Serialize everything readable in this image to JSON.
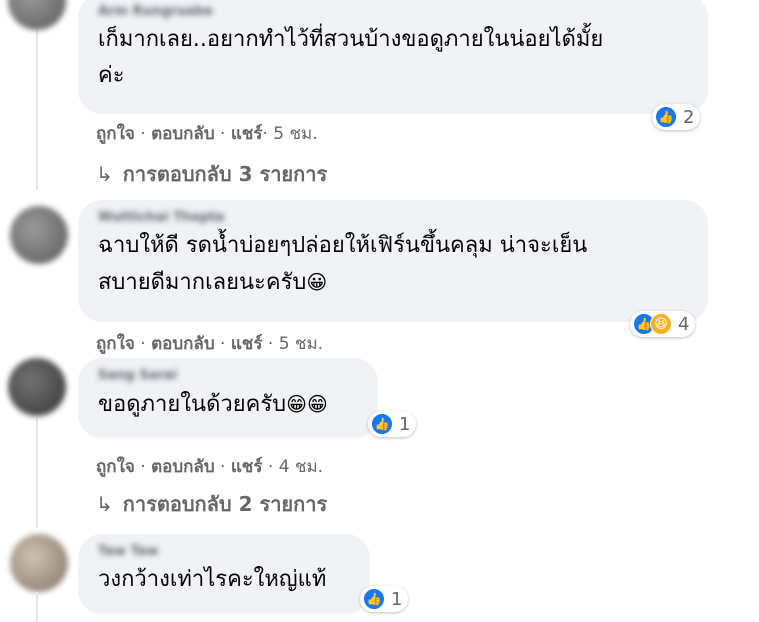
{
  "comments": [
    {
      "author": "Arm Rungruabe",
      "text": "เก็มากเลย..อยากทำไว้ที่สวนบ้างขอดูภายในน่อยได้มั้ย\nค่ะ",
      "reaction_count": "2",
      "like": "ถูกใจ",
      "reply": "ตอบกลับ",
      "share": "แชร์",
      "time": "5 ชม.",
      "replies_label": "การตอบกลับ 3 รายการ"
    },
    {
      "author": "Wuttichai Thepta",
      "text": "ฉาบให้ดี รดน้ำบ่อยๆปล่อยให้เฟิร์นขึ้นคลุม น่าจะเย็น\nสบายดีมากเลยนะครับ",
      "emoji": "😀",
      "reaction_count": "4",
      "like": "ถูกใจ",
      "reply": "ตอบกลับ",
      "share": "แชร์",
      "time": "5 ชม."
    },
    {
      "author": "Sang Sarai",
      "text": "ขอดูภายในด้วยครับ",
      "emoji": "😁😁",
      "reaction_count": "1",
      "like": "ถูกใจ",
      "reply": "ตอบกลับ",
      "share": "แชร์",
      "time": "4 ชม.",
      "replies_label": "การตอบกลับ 2 รายการ"
    },
    {
      "author": "Taw Taw",
      "text": "วงกว้างเท่าไรคะใหญ่แท้",
      "reaction_count": "1"
    }
  ],
  "colors": {
    "like": "#1877f2",
    "haha": "#f7b125",
    "bubble": "#f0f2f5",
    "meta": "#65676b"
  }
}
